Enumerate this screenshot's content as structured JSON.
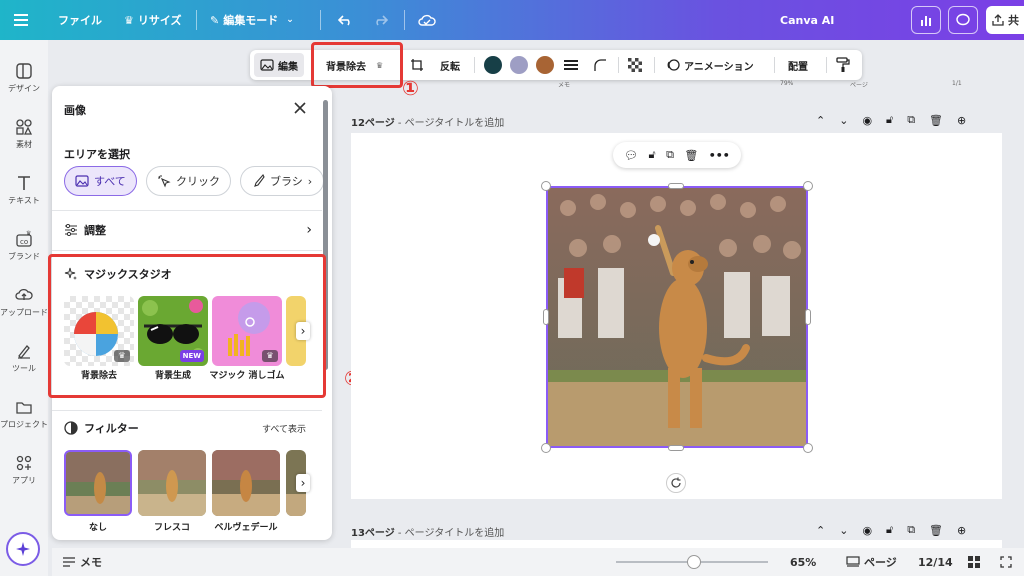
{
  "topbar": {
    "file": "ファイル",
    "resize": "リサイズ",
    "edit_mode": "編集モード",
    "title": "Canva AI",
    "share": "共"
  },
  "rail": {
    "items": [
      {
        "label": "デザイン",
        "icon": "layout-icon"
      },
      {
        "label": "素材",
        "icon": "shapes-icon"
      },
      {
        "label": "テキスト",
        "icon": "text-icon"
      },
      {
        "label": "ブランド",
        "icon": "brand-icon"
      },
      {
        "label": "アップロード",
        "icon": "upload-icon"
      },
      {
        "label": "ツール",
        "icon": "pen-icon"
      },
      {
        "label": "プロジェクト",
        "icon": "folder-icon"
      },
      {
        "label": "アプリ",
        "icon": "apps-icon"
      }
    ]
  },
  "context_toolbar": {
    "edit": "編集",
    "bg_remove": "背景除去",
    "flip": "反転",
    "colors": [
      "#173f47",
      "#9e9ec4",
      "#a86434"
    ],
    "animation": "アニメーション",
    "position": "配置"
  },
  "annotations": {
    "one": "①",
    "two": "②"
  },
  "panel": {
    "title": "画像",
    "select_area": "エリアを選択",
    "chips": [
      "すべて",
      "クリック",
      "ブラシ"
    ],
    "adjust": "調整",
    "magic_studio": "マジックスタジオ",
    "magic_items": [
      {
        "label": "背景除去",
        "badge": "♛"
      },
      {
        "label": "背景生成",
        "badge": "NEW"
      },
      {
        "label": "マジック 消しゴム",
        "badge": "♛"
      }
    ],
    "filter": "フィルター",
    "show_all": "すべて表示",
    "filters": [
      "なし",
      "フレスコ",
      "ベルヴェデール"
    ]
  },
  "canvas": {
    "page12_num": "12ページ",
    "page12_title": " - ページタイトルを追加",
    "page13_num": "13ページ",
    "page13_title": " - ページタイトルを追加"
  },
  "mini_ruler": {
    "zoom": "79%",
    "page": "ページ",
    "count": "1/1",
    "memo": "メモ"
  },
  "bottombar": {
    "memo": "メモ",
    "zoom_value": 0.65,
    "zoom": "65%",
    "pages": "ページ",
    "page_count": "12/14"
  }
}
